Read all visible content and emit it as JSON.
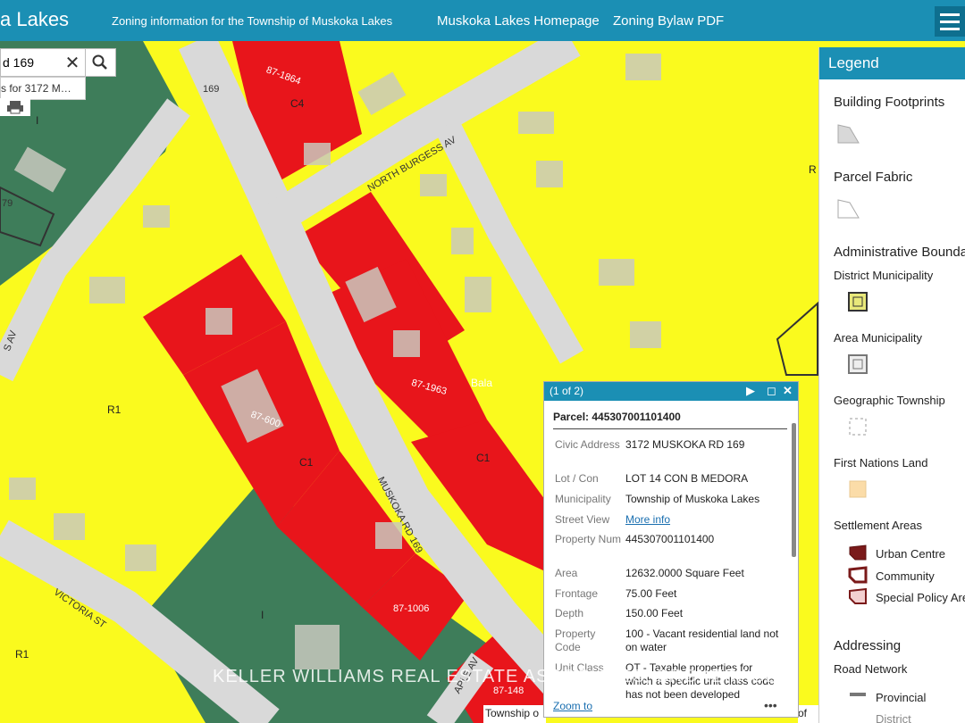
{
  "header": {
    "title": "a Lakes",
    "subtitle": "Zoning information for the Township of Muskoka Lakes",
    "nav_home": "Muskoka Lakes Homepage",
    "nav_pdf": "Zoning Bylaw PDF",
    "menu_icon": "menu-icon"
  },
  "search": {
    "value": "d 169",
    "suggestion": "s for 3172 M…"
  },
  "map_labels": {
    "road_169": "169",
    "north_burgess": "NORTH BURGESS AV",
    "muskoka_rd": "MUSKOKA RD 169",
    "victoria_st": "VICTORIA ST",
    "maple_av": "APLE AV",
    "s_av": "S AV",
    "bala": "Bala",
    "parcel_1864": "87-1864",
    "parcel_1963": "87-1963",
    "parcel_600": "87-600",
    "parcel_1006": "87-1006",
    "parcel_148": "87-148",
    "parcel_79": "79",
    "zone_c4": "C4",
    "zone_c1a": "C1",
    "zone_c1b": "C1",
    "zone_r1a": "R1",
    "zone_r1b": "R1",
    "zone_i_a": "I",
    "zone_i_b": "I",
    "zone_r_edge": "R"
  },
  "legend": {
    "title": "Legend",
    "building_footprints": "Building Footprints",
    "parcel_fabric": "Parcel Fabric",
    "admin_boundaries": "Administrative Bounda",
    "district_municipality": "District Municipality",
    "area_municipality": "Area Municipality",
    "geographic_township": "Geographic Township",
    "first_nations_land": "First Nations Land",
    "settlement_areas": "Settlement Areas",
    "urban_centre": "Urban Centre",
    "community": "Community",
    "special_policy": "Special Policy Are",
    "addressing": "Addressing",
    "road_network": "Road Network",
    "provincial": "Provincial",
    "district_partial": "District"
  },
  "popup": {
    "count": "(1 of 2)",
    "parcel_title": "Parcel: 445307001101400",
    "rows": [
      {
        "key": "Civic Address",
        "value": "3172 MUSKOKA RD 169"
      },
      {
        "key": "Lot / Con",
        "value": "LOT 14 CON B MEDORA"
      },
      {
        "key": "Municipality",
        "value": "Township of Muskoka Lakes"
      },
      {
        "key": "Street View",
        "value": "More info"
      },
      {
        "key": "Property Num",
        "value": "445307001101400"
      },
      {
        "key": "Area",
        "value": "12632.0000 Square Feet"
      },
      {
        "key": "Frontage",
        "value": "75.00 Feet"
      },
      {
        "key": "Depth",
        "value": "150.00 Feet"
      },
      {
        "key": "Property Code",
        "value": "100 - Vacant residential land not on water"
      },
      {
        "key": "Unit Class",
        "value": "OT - Taxable properties for which a specific unit class code has not been developed"
      }
    ],
    "zoom_to": "Zoom to",
    "more": "•••"
  },
  "attribution": "Township o",
  "attribution_right": "of",
  "watermark": "KELLER WILLIAMS REAL ESTATE ASSOCIATES, BROKERAGE",
  "colors": {
    "header": "#1b8fb4",
    "residential_yellow": "#fafa1e",
    "commercial_red": "#e8151b",
    "institutional_green": "#3e7d5a",
    "road_grey": "#d9d9d9"
  }
}
